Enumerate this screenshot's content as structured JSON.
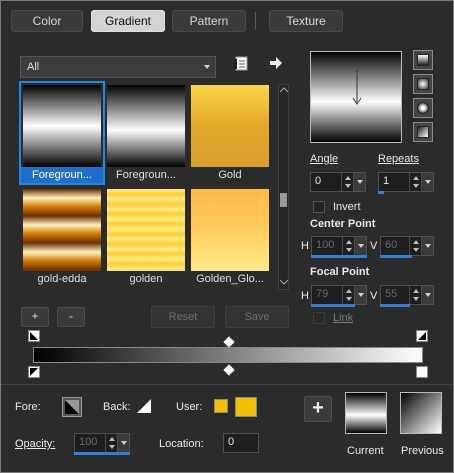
{
  "tabs": [
    {
      "label": "Color",
      "active": false
    },
    {
      "label": "Gradient",
      "active": true
    },
    {
      "label": "Pattern",
      "active": false
    },
    {
      "label": "Texture",
      "active": false
    }
  ],
  "category": {
    "selected": "All"
  },
  "gradients": [
    {
      "label": "Foregroun...",
      "selected": true
    },
    {
      "label": "Foregroun...",
      "selected": false
    },
    {
      "label": "Gold",
      "selected": false
    },
    {
      "label": "gold-edda",
      "selected": false
    },
    {
      "label": "golden",
      "selected": false
    },
    {
      "label": "Golden_Glo...",
      "selected": false
    }
  ],
  "buttons": {
    "add": "+",
    "remove": "-",
    "reset": "Reset",
    "save": "Save",
    "add_big": "+"
  },
  "angle": {
    "label": "Angle",
    "value": "0"
  },
  "repeats": {
    "label": "Repeats",
    "value": "1"
  },
  "invert": {
    "label": "Invert",
    "checked": false
  },
  "center_point": {
    "label": "Center Point",
    "h_label": "H",
    "h_value": "100",
    "v_label": "V",
    "v_value": "60"
  },
  "focal_point": {
    "label": "Focal Point",
    "h_label": "H",
    "h_value": "79",
    "v_label": "V",
    "v_value": "55"
  },
  "link": {
    "label": "Link",
    "checked": false
  },
  "bottom": {
    "fore_label": "Fore:",
    "back_label": "Back:",
    "user_label": "User:",
    "opacity_label": "Opacity:",
    "opacity_value": "100",
    "location_label": "Location:",
    "location_value": "0",
    "current_label": "Current",
    "previous_label": "Previous"
  },
  "colors": {
    "user_swatch": "#f5c000",
    "accent": "#1e88e5"
  }
}
